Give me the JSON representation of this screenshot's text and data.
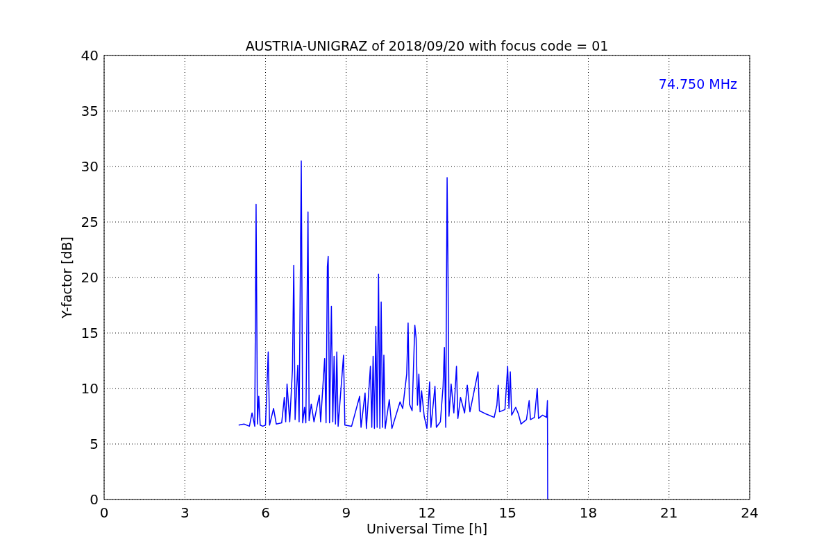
{
  "chart_data": {
    "type": "line",
    "title": "AUSTRIA-UNIGRAZ of 2018/09/20 with focus code = 01",
    "xlabel": "Universal Time [h]",
    "ylabel": "Y-factor [dB]",
    "x": [
      5.0,
      5.2,
      5.4,
      5.5,
      5.6,
      5.65,
      5.7,
      5.75,
      5.8,
      5.9,
      6.0,
      6.1,
      6.15,
      6.3,
      6.4,
      6.6,
      6.7,
      6.75,
      6.8,
      6.9,
      7.0,
      7.05,
      7.1,
      7.2,
      7.25,
      7.33,
      7.38,
      7.45,
      7.5,
      7.58,
      7.62,
      7.7,
      7.8,
      8.0,
      8.05,
      8.2,
      8.25,
      8.3,
      8.33,
      8.38,
      8.45,
      8.5,
      8.55,
      8.6,
      8.65,
      8.7,
      8.9,
      8.95,
      9.2,
      9.5,
      9.55,
      9.7,
      9.75,
      9.9,
      9.95,
      10.0,
      10.05,
      10.1,
      10.15,
      10.2,
      10.25,
      10.3,
      10.35,
      10.4,
      10.45,
      10.6,
      10.7,
      10.8,
      11.0,
      11.1,
      11.25,
      11.3,
      11.35,
      11.45,
      11.55,
      11.6,
      11.65,
      11.7,
      11.75,
      11.8,
      11.9,
      12.0,
      12.1,
      12.15,
      12.3,
      12.35,
      12.5,
      12.6,
      12.65,
      12.7,
      12.75,
      12.78,
      12.82,
      12.9,
      13.0,
      13.1,
      13.15,
      13.25,
      13.4,
      13.5,
      13.6,
      13.9,
      13.95,
      14.2,
      14.5,
      14.6,
      14.65,
      14.7,
      14.9,
      15.0,
      15.05,
      15.1,
      15.15,
      15.3,
      15.4,
      15.5,
      15.7,
      15.8,
      15.85,
      16.0,
      16.1,
      16.15,
      16.3,
      16.45,
      16.48,
      16.49
    ],
    "series": [
      {
        "name": "74.750 MHz",
        "color": "#0000ff",
        "values": [
          6.7,
          6.8,
          6.6,
          7.8,
          6.6,
          26.6,
          6.8,
          9.3,
          6.7,
          6.6,
          6.7,
          13.3,
          6.7,
          8.2,
          6.8,
          6.9,
          9.2,
          7.0,
          10.4,
          7.0,
          11.7,
          21.1,
          7.2,
          12.1,
          7.0,
          30.5,
          6.9,
          8.3,
          6.9,
          25.9,
          7.1,
          8.6,
          7.0,
          9.4,
          7.0,
          12.7,
          6.9,
          21.0,
          21.9,
          6.9,
          17.4,
          7.0,
          12.9,
          6.8,
          13.3,
          6.6,
          13.0,
          6.7,
          6.6,
          9.3,
          6.5,
          9.6,
          6.4,
          12.0,
          6.5,
          12.9,
          6.4,
          15.6,
          6.5,
          20.3,
          6.4,
          17.8,
          6.5,
          13.0,
          6.4,
          9.0,
          6.4,
          7.2,
          8.8,
          8.2,
          11.3,
          15.9,
          8.6,
          8.0,
          15.7,
          14.5,
          8.5,
          11.3,
          7.9,
          9.8,
          7.5,
          6.4,
          10.6,
          6.5,
          10.2,
          6.5,
          7.0,
          10.2,
          13.7,
          6.5,
          29.0,
          22.0,
          7.5,
          10.4,
          7.8,
          12.0,
          7.3,
          9.2,
          7.8,
          10.3,
          7.9,
          11.5,
          8.0,
          7.7,
          7.4,
          8.5,
          10.3,
          7.9,
          8.1,
          12.0,
          8.2,
          11.5,
          7.6,
          8.3,
          7.7,
          6.8,
          7.2,
          8.9,
          7.2,
          7.4,
          10.0,
          7.3,
          7.6,
          7.4,
          8.9,
          0
        ]
      }
    ],
    "xlim": [
      0,
      24
    ],
    "ylim": [
      0,
      40
    ],
    "xticks": [
      0,
      3,
      6,
      9,
      12,
      15,
      18,
      21,
      24
    ],
    "yticks": [
      0,
      5,
      10,
      15,
      20,
      25,
      30,
      35,
      40
    ],
    "grid": true
  }
}
